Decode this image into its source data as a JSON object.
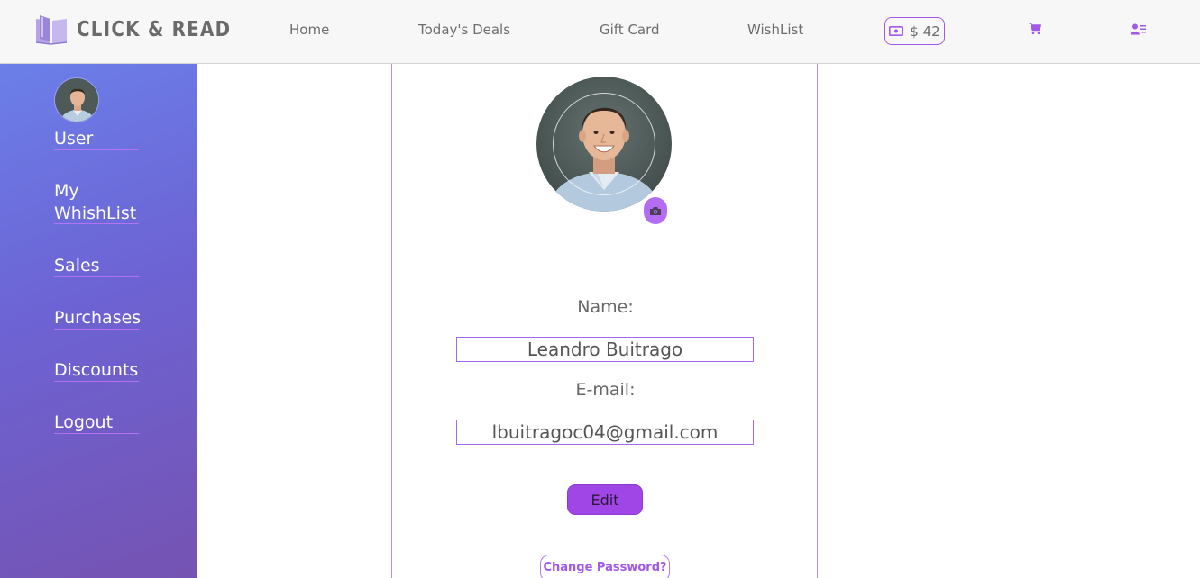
{
  "header": {
    "logo_text": "CLICK & READ",
    "nav": {
      "home": "Home",
      "deals": "Today's Deals",
      "gift_card": "Gift Card",
      "wishlist": "WishList"
    },
    "wallet_amount": "$ 42",
    "icons": [
      "book-logo-icon",
      "money-bill-icon",
      "cart-icon",
      "user-list-icon"
    ]
  },
  "sidebar": {
    "items": [
      {
        "label": "User"
      },
      {
        "label": "My WhishList"
      },
      {
        "label": "Sales"
      },
      {
        "label": "Purchases"
      },
      {
        "label": "Discounts"
      },
      {
        "label": "Logout"
      }
    ]
  },
  "profile": {
    "name_label": "Name:",
    "name_value": "Leandro Buitrago",
    "email_label": "E-mail:",
    "email_value": "lbuitragoc04@gmail.com",
    "edit_label": "Edit",
    "change_password_label": "Change Password?"
  },
  "colors": {
    "accent": "#a259e8",
    "sidebar_top": "#6b7fe9",
    "sidebar_bottom": "#7553b2",
    "edit_button": "#a146e6"
  }
}
